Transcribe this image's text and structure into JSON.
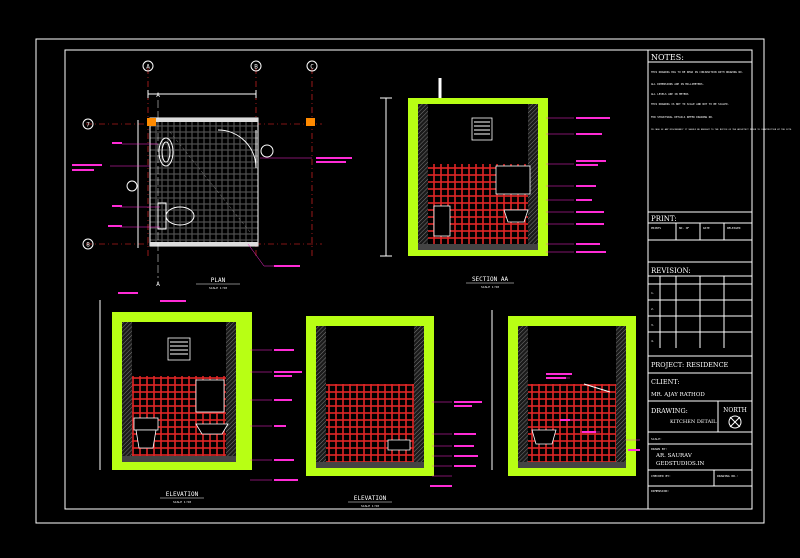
{
  "notes": {
    "heading": "NOTES:",
    "lines": [
      "THIS DRAWING HAS TO BE READ IN CONJUNCTION WITH DRAWING NO.",
      "ALL DIMENSIONS ARE IN MILLIMETERS.",
      "ALL LEVELS ARE IN METERS",
      "THIS DRAWING IS NOT TO SCALE AND NOT TO BE SCALED.",
      "FOR STRUCTURAL DETAILS REFER DRAWING NO.",
      "IN CASE OF ANY DISCREPANCY IT SHOULD BE BROUGHT TO THE NOTICE OF THE ARCHITECT PRIOR TO CONSTRUCTION AT THE SITE."
    ]
  },
  "title_block": {
    "print_label": "PRINT:",
    "print_cols": [
      "PRINTS",
      "NO. OF",
      "DATE",
      "RELEASED"
    ],
    "revision_label": "REVISION:",
    "revision_rows": [
      "1.",
      "2.",
      "3.",
      "4."
    ],
    "project_label": "PROJECT: RESIDENCE",
    "client_label": "CLIENT:",
    "client_name": "MR. AJAY RATHOD",
    "drawing_label": "DRAWING:",
    "drawing_name": "KITCHEN DETAIL",
    "north_label": "NORTH",
    "scale_label": "SCALE:",
    "drawn_by_label": "DRAWN BY:",
    "drawn_by": "AR. SAURAV",
    "architect": "GEDSTUDIOS.IN",
    "checked_label": "CHECKED BY:",
    "drawing_no_label": "DRAWING NO.:",
    "dimension_label": "DIMENSION:"
  },
  "views": {
    "plan": {
      "title": "PLAN",
      "scale": "SCALE 1:50"
    },
    "section": {
      "title": "SECTION AA",
      "scale": "SCALE 1:50"
    },
    "elevation1": {
      "title": "ELEVATION",
      "scale": "SCALE 1:50"
    },
    "elevation2": {
      "title": "ELEVATION",
      "scale": "SCALE 1:50"
    }
  },
  "grid_labels": [
    "A",
    "B",
    "C",
    "7",
    "8"
  ],
  "section_markers": [
    "A",
    "A"
  ],
  "colors": {
    "background": "#000000",
    "wall": "#b8ff14",
    "tile": "#ff2b2b",
    "annotation": "#ff2bd6",
    "linework": "#ffffff"
  }
}
